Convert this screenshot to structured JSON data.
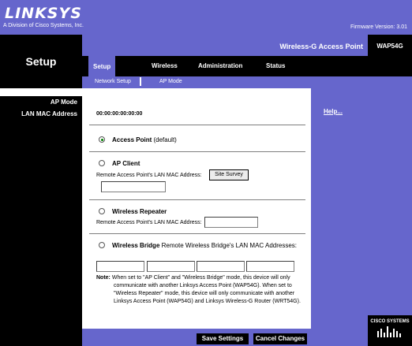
{
  "brand": {
    "logo": "LINKSYS",
    "tagline": "A Division of Cisco Systems, Inc.",
    "firmware": "Firmware Version: 3.01"
  },
  "page": {
    "title": "Setup"
  },
  "product": {
    "name": "Wireless-G Access Point",
    "model": "WAP54G"
  },
  "tabs": [
    {
      "label": "Setup"
    },
    {
      "label": "Wireless"
    },
    {
      "label": "Administration"
    },
    {
      "label": "Status"
    }
  ],
  "subnav": [
    {
      "label": "Network Setup"
    },
    {
      "label": "AP Mode"
    }
  ],
  "sidebar": {
    "section": "AP Mode",
    "mac_label": "LAN MAC Address"
  },
  "help_link": "Help...",
  "mac_value": "00:00:00:00:00:00",
  "modes": {
    "access_point": {
      "label": "Access Point",
      "suffix": "(default)"
    },
    "ap_client": {
      "label": "AP Client",
      "field_label": "Remote Access Point's LAN MAC Address:",
      "button": "Site Survey",
      "value": ""
    },
    "repeater": {
      "label": "Wireless Repeater",
      "field_label": "Remote Access Point's LAN MAC Address:",
      "value": ""
    },
    "bridge": {
      "label": "Wireless Bridge",
      "field_label": "Remote Wireless Bridge's LAN MAC Addresses:",
      "values": [
        "",
        "",
        "",
        ""
      ]
    }
  },
  "note": {
    "label": "Note:",
    "line1": "When set to \"AP Client\" and \"Wireless Bridge\" mode, this device will only",
    "line2": "communicate with another Linksys Access Point (WAP54G). When set to",
    "line3": "\"Wireless Repeater\" mode, this device will only communicate with another",
    "line4": "Linksys Access Point (WAP54G) and Linksys Wireless-G Router (WRT54G)."
  },
  "footer": {
    "save": "Save Settings",
    "cancel": "Cancel Changes"
  },
  "cisco": {
    "label": "CISCO SYSTEMS"
  },
  "colors": {
    "accent": "#6666cc",
    "black": "#000000"
  }
}
